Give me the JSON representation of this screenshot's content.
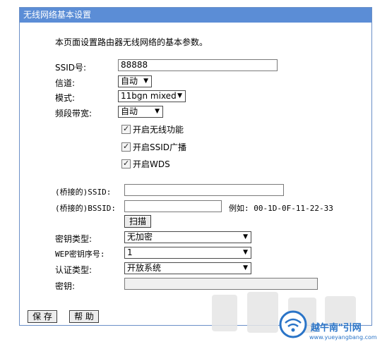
{
  "title": "无线网络基本设置",
  "description": "本页面设置路由器无线网络的基本参数。",
  "fields": {
    "ssid_label": "SSID号:",
    "ssid_value": "88888",
    "channel_label": "信道:",
    "channel_value": "自动",
    "mode_label": "模式:",
    "mode_value": "11bgn mixed",
    "bandwidth_label": "频段带宽:",
    "bandwidth_value": "自动"
  },
  "checkboxes": {
    "wireless": "开启无线功能",
    "ssid_broadcast": "开启SSID广播",
    "wds": "开启WDS"
  },
  "wds": {
    "bridge_ssid_label": "(桥接的)SSID:",
    "bridge_ssid_value": "",
    "bridge_bssid_label": "(桥接的)BSSID:",
    "bridge_bssid_value": "",
    "example": "例如: 00-1D-0F-11-22-33",
    "scan_button": "扫描",
    "key_type_label": "密钥类型:",
    "key_type_value": "无加密",
    "wep_index_label": "WEP密钥序号:",
    "wep_index_value": "1",
    "auth_type_label": "认证类型:",
    "auth_type_value": "开放系统",
    "key_label": "密钥:",
    "key_value": ""
  },
  "buttons": {
    "save": "保 存",
    "help": "帮 助"
  },
  "watermark": {
    "brand": "越午南\"引网",
    "url": "www.yueyangbang.com"
  },
  "colors": {
    "titlebar": "#5b8dd6",
    "border": "#6a8fc7"
  }
}
